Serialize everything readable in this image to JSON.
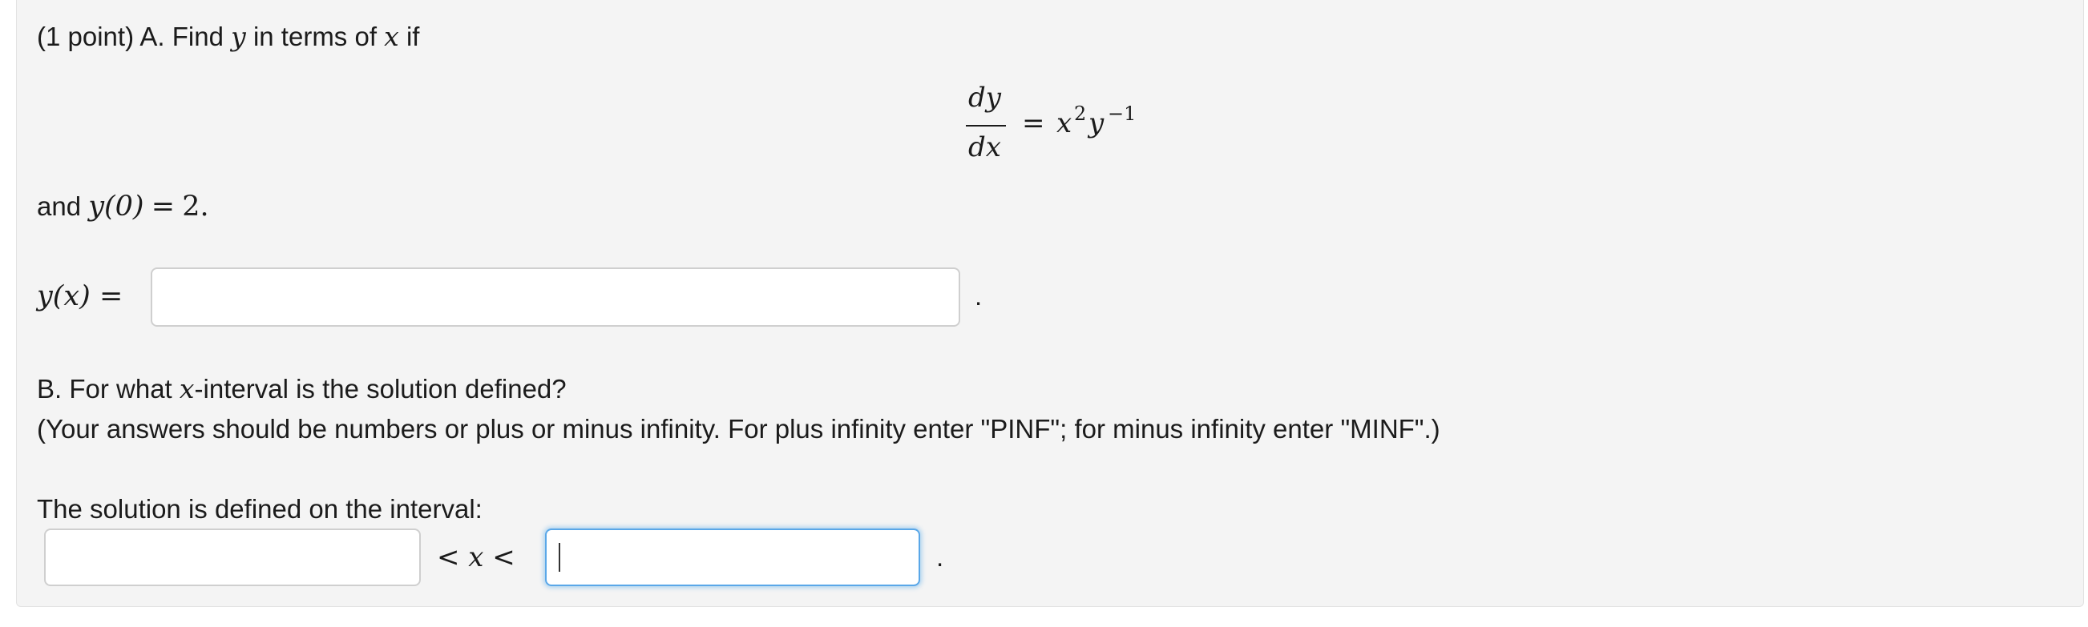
{
  "part_a": {
    "intro_prefix": "(1 point) A. Find",
    "var_y": "y",
    "intro_middle": "in terms of",
    "var_x": "x",
    "intro_suffix": "if",
    "equation": {
      "numerator": "dy",
      "denominator": "dx",
      "equals": "=",
      "rhs_base_x": "x",
      "rhs_exp_x": "2",
      "rhs_base_y": "y",
      "rhs_exp_y": "−1"
    },
    "condition_prefix": "and",
    "condition_math": "y(0)",
    "condition_equals": "=",
    "condition_value": "2.",
    "answer_label": "y(x) =",
    "answer_value": "",
    "answer_suffix": "."
  },
  "part_b": {
    "question_prefix": "B. For what",
    "question_var": "x",
    "question_suffix": "-interval is the solution defined?",
    "instructions": "(Your answers should be numbers or plus or minus infinity. For plus infinity enter \"PINF\"; for minus infinity enter \"MINF\".)",
    "interval_label": "The solution is defined on the interval:",
    "lower_value": "",
    "inequality": "< x <",
    "upper_value": "",
    "interval_suffix": "."
  }
}
